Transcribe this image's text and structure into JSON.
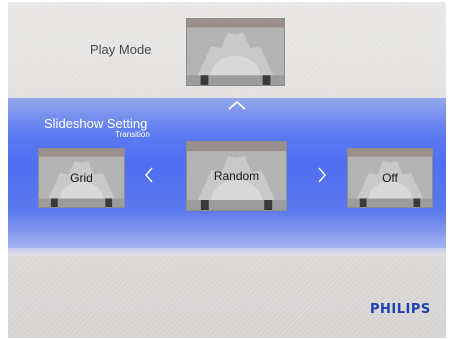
{
  "play_mode": {
    "label": "Play Mode"
  },
  "slideshow": {
    "title": "Slideshow Setting",
    "subtitle": "Transition",
    "options": {
      "previous": "Grid",
      "current": "Random",
      "next": "Off"
    }
  },
  "brand": {
    "logo": "PHILIPS",
    "color": "#1e41b4"
  },
  "icons": {
    "up": "chevron-up-icon",
    "left": "chevron-left-icon",
    "right": "chevron-right-icon"
  },
  "colors": {
    "band": "#4f6ff2",
    "background": "#e0dedc"
  }
}
